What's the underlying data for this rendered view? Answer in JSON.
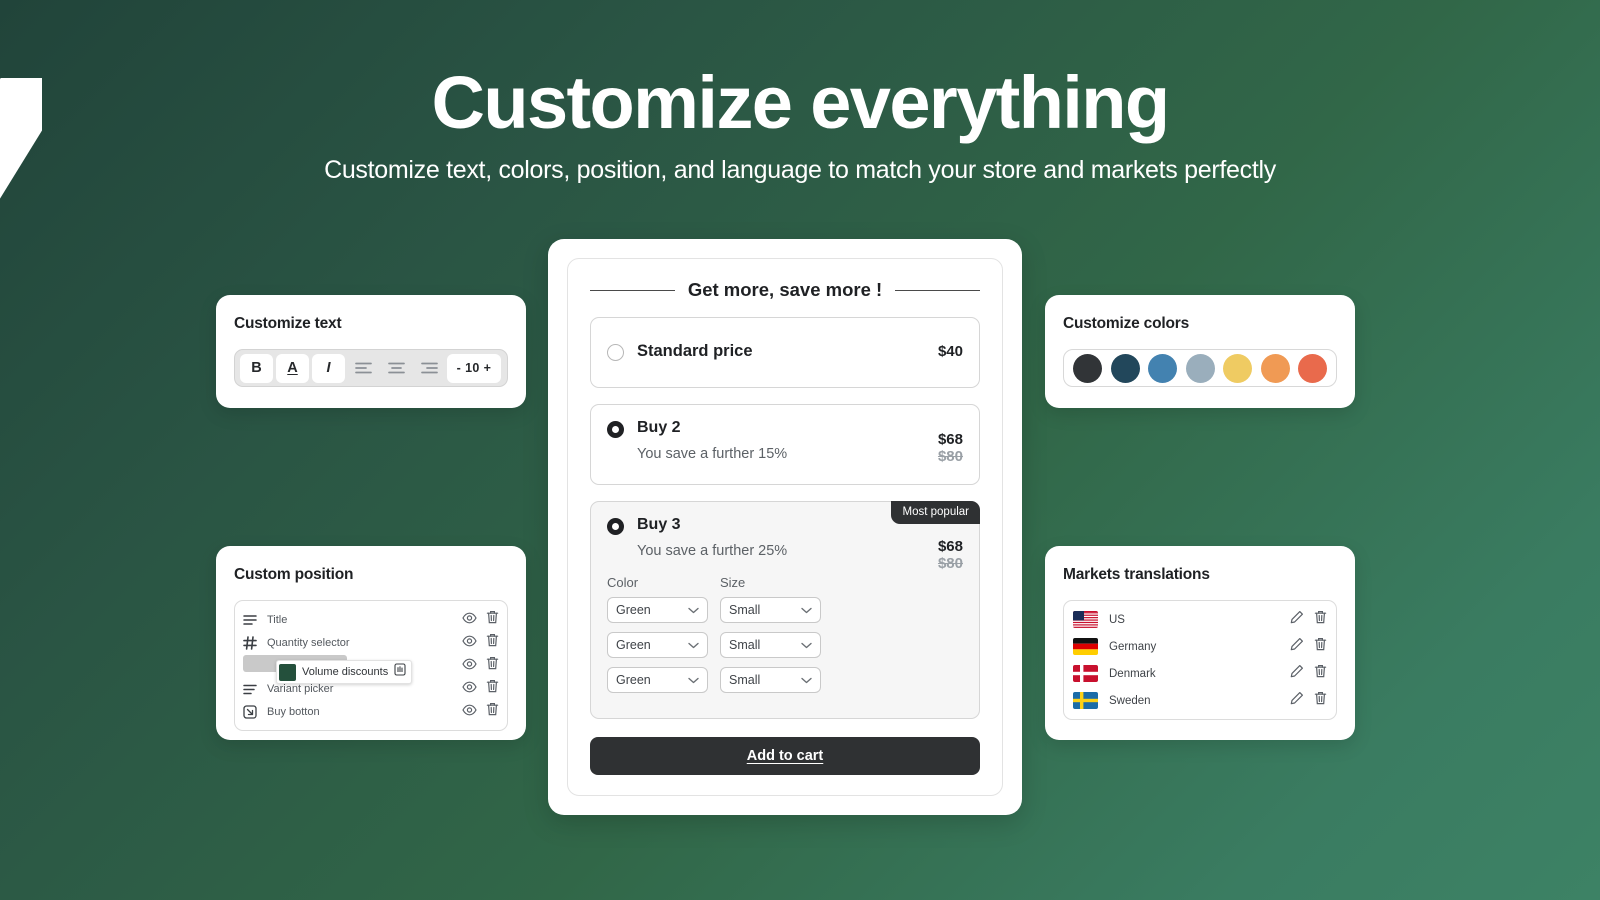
{
  "hero": {
    "title": "Customize everything",
    "subtitle": "Customize text, colors, position, and language to match your store and markets perfectly"
  },
  "theme": {
    "bg_dark": "#21443a",
    "bg_light": "#3d8265",
    "dark_ui": "#2f3133",
    "drag_green": "#24503c"
  },
  "customize_text": {
    "title": "Customize text",
    "buttons": [
      {
        "label": "B",
        "name": "bold-button"
      },
      {
        "label": "A",
        "name": "font-color-button"
      },
      {
        "label": "I",
        "name": "italic-button"
      }
    ],
    "align_icons": [
      "align-left-icon",
      "align-center-icon",
      "align-right-icon"
    ],
    "stepper": "- 10 +"
  },
  "customize_colors": {
    "title": "Customize colors",
    "swatches": [
      {
        "name": "swatch-charcoal",
        "hex": "#313437"
      },
      {
        "name": "swatch-dark-teal",
        "hex": "#22475b"
      },
      {
        "name": "swatch-blue",
        "hex": "#4382b0"
      },
      {
        "name": "swatch-slate-blue",
        "hex": "#9aaebc"
      },
      {
        "name": "swatch-yellow",
        "hex": "#efcb62"
      },
      {
        "name": "swatch-orange",
        "hex": "#f09a54"
      },
      {
        "name": "swatch-red-orange",
        "hex": "#e96a4c"
      }
    ]
  },
  "custom_position": {
    "title": "Custom position",
    "rows": [
      {
        "label": "Title",
        "icon": "text-lines-icon"
      },
      {
        "label": "Quantity selector",
        "icon": "hash-icon"
      },
      {
        "label": "",
        "icon": "placeholder-icon",
        "is_drag_slot": true
      },
      {
        "label": "Variant picker",
        "icon": "filter-lines-icon"
      },
      {
        "label": "Buy botton",
        "icon": "cursor-box-icon"
      }
    ],
    "dragged_item": {
      "label": "Volume discounts",
      "grab_icon": "grab-hand-icon"
    },
    "row_actions": [
      "eye-icon",
      "trash-icon"
    ]
  },
  "markets": {
    "title": "Markets translations",
    "rows": [
      {
        "label": "US",
        "flag": "flag-us"
      },
      {
        "label": "Germany",
        "flag": "flag-de"
      },
      {
        "label": "Denmark",
        "flag": "flag-dk"
      },
      {
        "label": "Sweden",
        "flag": "flag-se"
      }
    ],
    "row_actions": [
      "pencil-icon",
      "trash-icon"
    ]
  },
  "product": {
    "offer_heading": "Get more, save more !",
    "tiers": [
      {
        "title": "Standard price",
        "subtitle": "",
        "price_now": "$40",
        "price_was": "",
        "selected": false,
        "badge": ""
      },
      {
        "title": "Buy 2",
        "subtitle": "You save a further 15%",
        "price_now": "$68",
        "price_was": "$80",
        "selected": true,
        "badge": ""
      },
      {
        "title": "Buy 3",
        "subtitle": "You save a further 25%",
        "price_now": "$68",
        "price_was": "$80",
        "selected": true,
        "badge": "Most popular"
      }
    ],
    "variant_headers": [
      "Color",
      "Size"
    ],
    "variant_rows": [
      {
        "color": "Green",
        "size": "Small"
      },
      {
        "color": "Green",
        "size": "Small"
      },
      {
        "color": "Green",
        "size": "Small"
      }
    ],
    "add_to_cart": "Add to cart"
  }
}
